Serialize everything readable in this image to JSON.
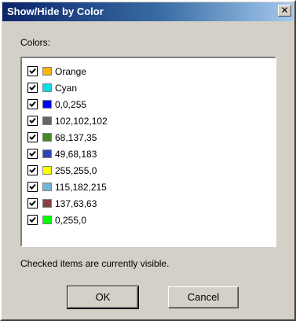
{
  "dialog": {
    "title": "Show/Hide by Color",
    "close_icon": "close-icon",
    "colors_label": "Colors:",
    "status_text": "Checked items are currently visible.",
    "ok_label": "OK",
    "cancel_label": "Cancel"
  },
  "items": [
    {
      "label": "Orange",
      "color": "#ffb400",
      "checked": true
    },
    {
      "label": "Cyan",
      "color": "#00e0e8",
      "checked": true
    },
    {
      "label": "0,0,255",
      "color": "#0000ff",
      "checked": true
    },
    {
      "label": "102,102,102",
      "color": "#666666",
      "checked": true
    },
    {
      "label": "68,137,35",
      "color": "#448923",
      "checked": true
    },
    {
      "label": "49,68,183",
      "color": "#3144b7",
      "checked": true
    },
    {
      "label": "255,255,0",
      "color": "#ffff00",
      "checked": true
    },
    {
      "label": "115,182,215",
      "color": "#73b6d7",
      "checked": true
    },
    {
      "label": "137,63,63",
      "color": "#893f3f",
      "checked": true
    },
    {
      "label": "0,255,0",
      "color": "#00ff00",
      "checked": true
    }
  ]
}
